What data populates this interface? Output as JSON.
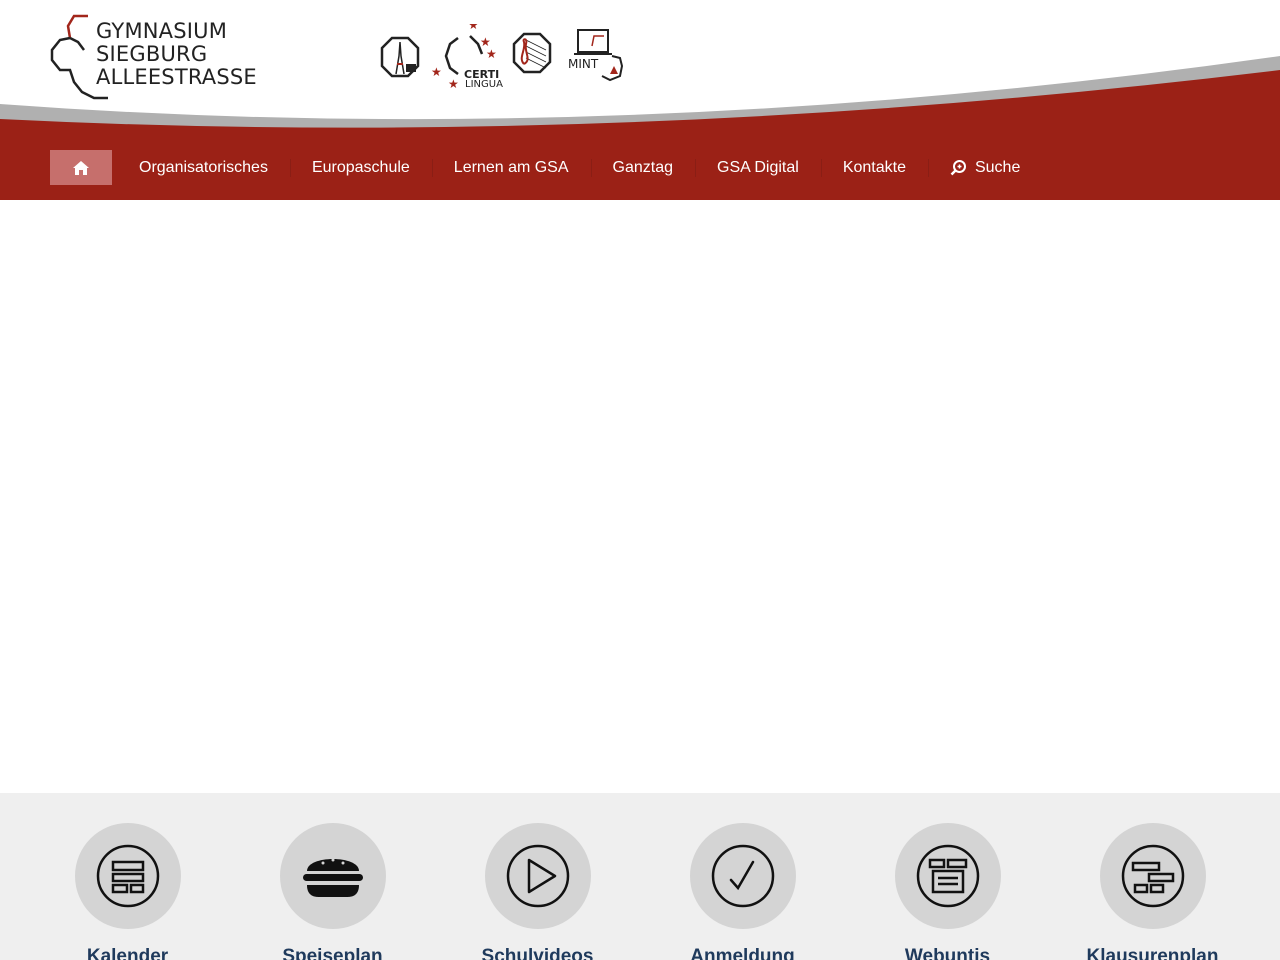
{
  "logo": {
    "line1": "GYMNASIUM",
    "line2": "SIEGBURG",
    "line3": "ALLEESTRASSE"
  },
  "badges": {
    "certilingua_line1": "CERTI",
    "certilingua_line2": "LINGUA",
    "mint": "MINT"
  },
  "nav": {
    "home_icon": "home-icon",
    "items": [
      {
        "label": "Organisatorisches"
      },
      {
        "label": "Europaschule"
      },
      {
        "label": "Lernen am GSA"
      },
      {
        "label": "Ganztag"
      },
      {
        "label": "GSA Digital"
      },
      {
        "label": "Kontakte"
      }
    ],
    "search_label": "Suche",
    "search_icon": "search-icon"
  },
  "quicklinks": [
    {
      "label": "Kalender",
      "icon": "calendar-icon"
    },
    {
      "label": "Speiseplan",
      "icon": "burger-icon"
    },
    {
      "label": "Schulvideos",
      "icon": "play-icon"
    },
    {
      "label": "Anmeldung",
      "icon": "checkmark-icon"
    },
    {
      "label": "Webuntis",
      "icon": "schedule-icon"
    },
    {
      "label": "Klausurenplan",
      "icon": "plan-icon"
    }
  ],
  "colors": {
    "brand_red": "#9b2116",
    "swoosh_grey": "#b0b0b0",
    "home_active": "#c66f6c",
    "footer_bg": "#efefef",
    "circle_bg": "#d4d4d4",
    "label_blue": "#1f3a5c"
  }
}
